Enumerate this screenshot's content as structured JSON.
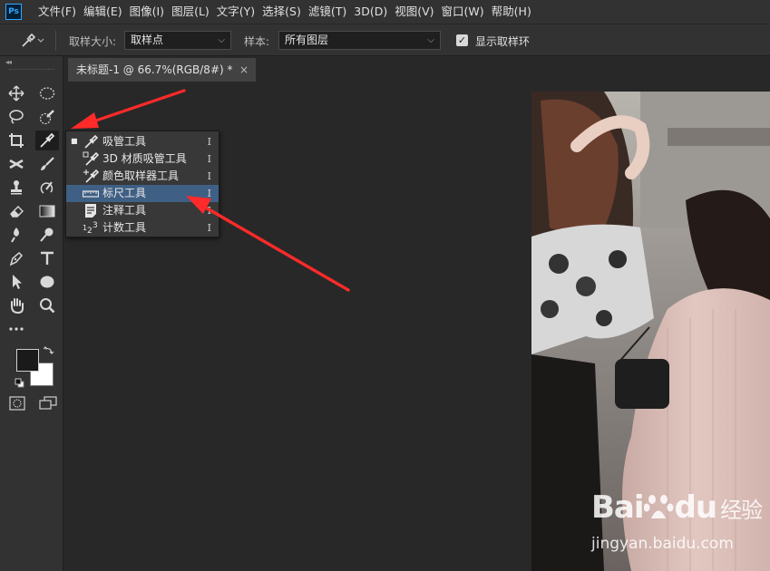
{
  "app": {
    "logo": "Ps"
  },
  "menu": [
    "文件(F)",
    "编辑(E)",
    "图像(I)",
    "图层(L)",
    "文字(Y)",
    "选择(S)",
    "滤镜(T)",
    "3D(D)",
    "视图(V)",
    "窗口(W)",
    "帮助(H)"
  ],
  "options": {
    "sample_size_label": "取样大小:",
    "sample_size_value": "取样点",
    "sample_label": "样本:",
    "sample_value": "所有图层",
    "show_ring_label": "显示取样环",
    "show_ring_checked": true
  },
  "document": {
    "tab_title": "未标题-1 @ 66.7%(RGB/8#) *",
    "close_glyph": "×"
  },
  "flyout": {
    "items": [
      {
        "label": "吸管工具",
        "key": "I",
        "icon": "eyedropper-icon",
        "active": true,
        "highlighted": false
      },
      {
        "label": "3D 材质吸管工具",
        "key": "I",
        "icon": "3d-material-eyedropper-icon",
        "active": false,
        "highlighted": false
      },
      {
        "label": "颜色取样器工具",
        "key": "I",
        "icon": "color-sampler-icon",
        "active": false,
        "highlighted": false
      },
      {
        "label": "标尺工具",
        "key": "I",
        "icon": "ruler-icon",
        "active": false,
        "highlighted": true
      },
      {
        "label": "注释工具",
        "key": "I",
        "icon": "note-icon",
        "active": false,
        "highlighted": false
      },
      {
        "label": "计数工具",
        "key": "I",
        "icon": "count-icon",
        "active": false,
        "highlighted": false
      }
    ]
  },
  "watermark": {
    "brand_left": "Bai",
    "brand_right": "du",
    "brand_cn": "经验",
    "url": "jingyan.baidu.com"
  },
  "colors": {
    "accent": "#31a8ff",
    "highlight": "#3f5f85",
    "arrow": "#ff2a2a"
  }
}
